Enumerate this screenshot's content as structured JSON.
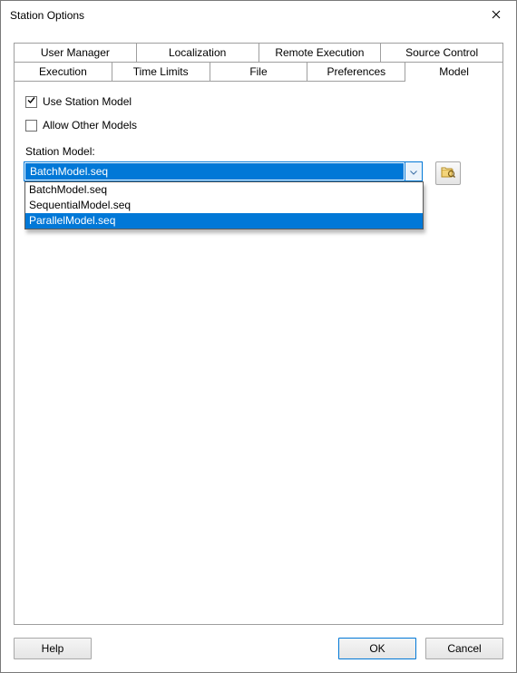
{
  "window": {
    "title": "Station Options"
  },
  "tabs": {
    "row1": [
      "User Manager",
      "Localization",
      "Remote Execution",
      "Source Control"
    ],
    "row2": [
      "Execution",
      "Time Limits",
      "File",
      "Preferences",
      "Model"
    ],
    "active": "Model"
  },
  "modelPage": {
    "useStationModel": {
      "label": "Use Station Model",
      "checked": true
    },
    "allowOtherModels": {
      "label": "Allow Other Models",
      "checked": false
    },
    "stationModelLabel": "Station Model:",
    "stationModel": {
      "value": "BatchModel.seq",
      "options": [
        "BatchModel.seq",
        "SequentialModel.seq",
        "ParallelModel.seq"
      ],
      "highlighted": "ParallelModel.seq"
    }
  },
  "buttons": {
    "help": "Help",
    "ok": "OK",
    "cancel": "Cancel"
  }
}
